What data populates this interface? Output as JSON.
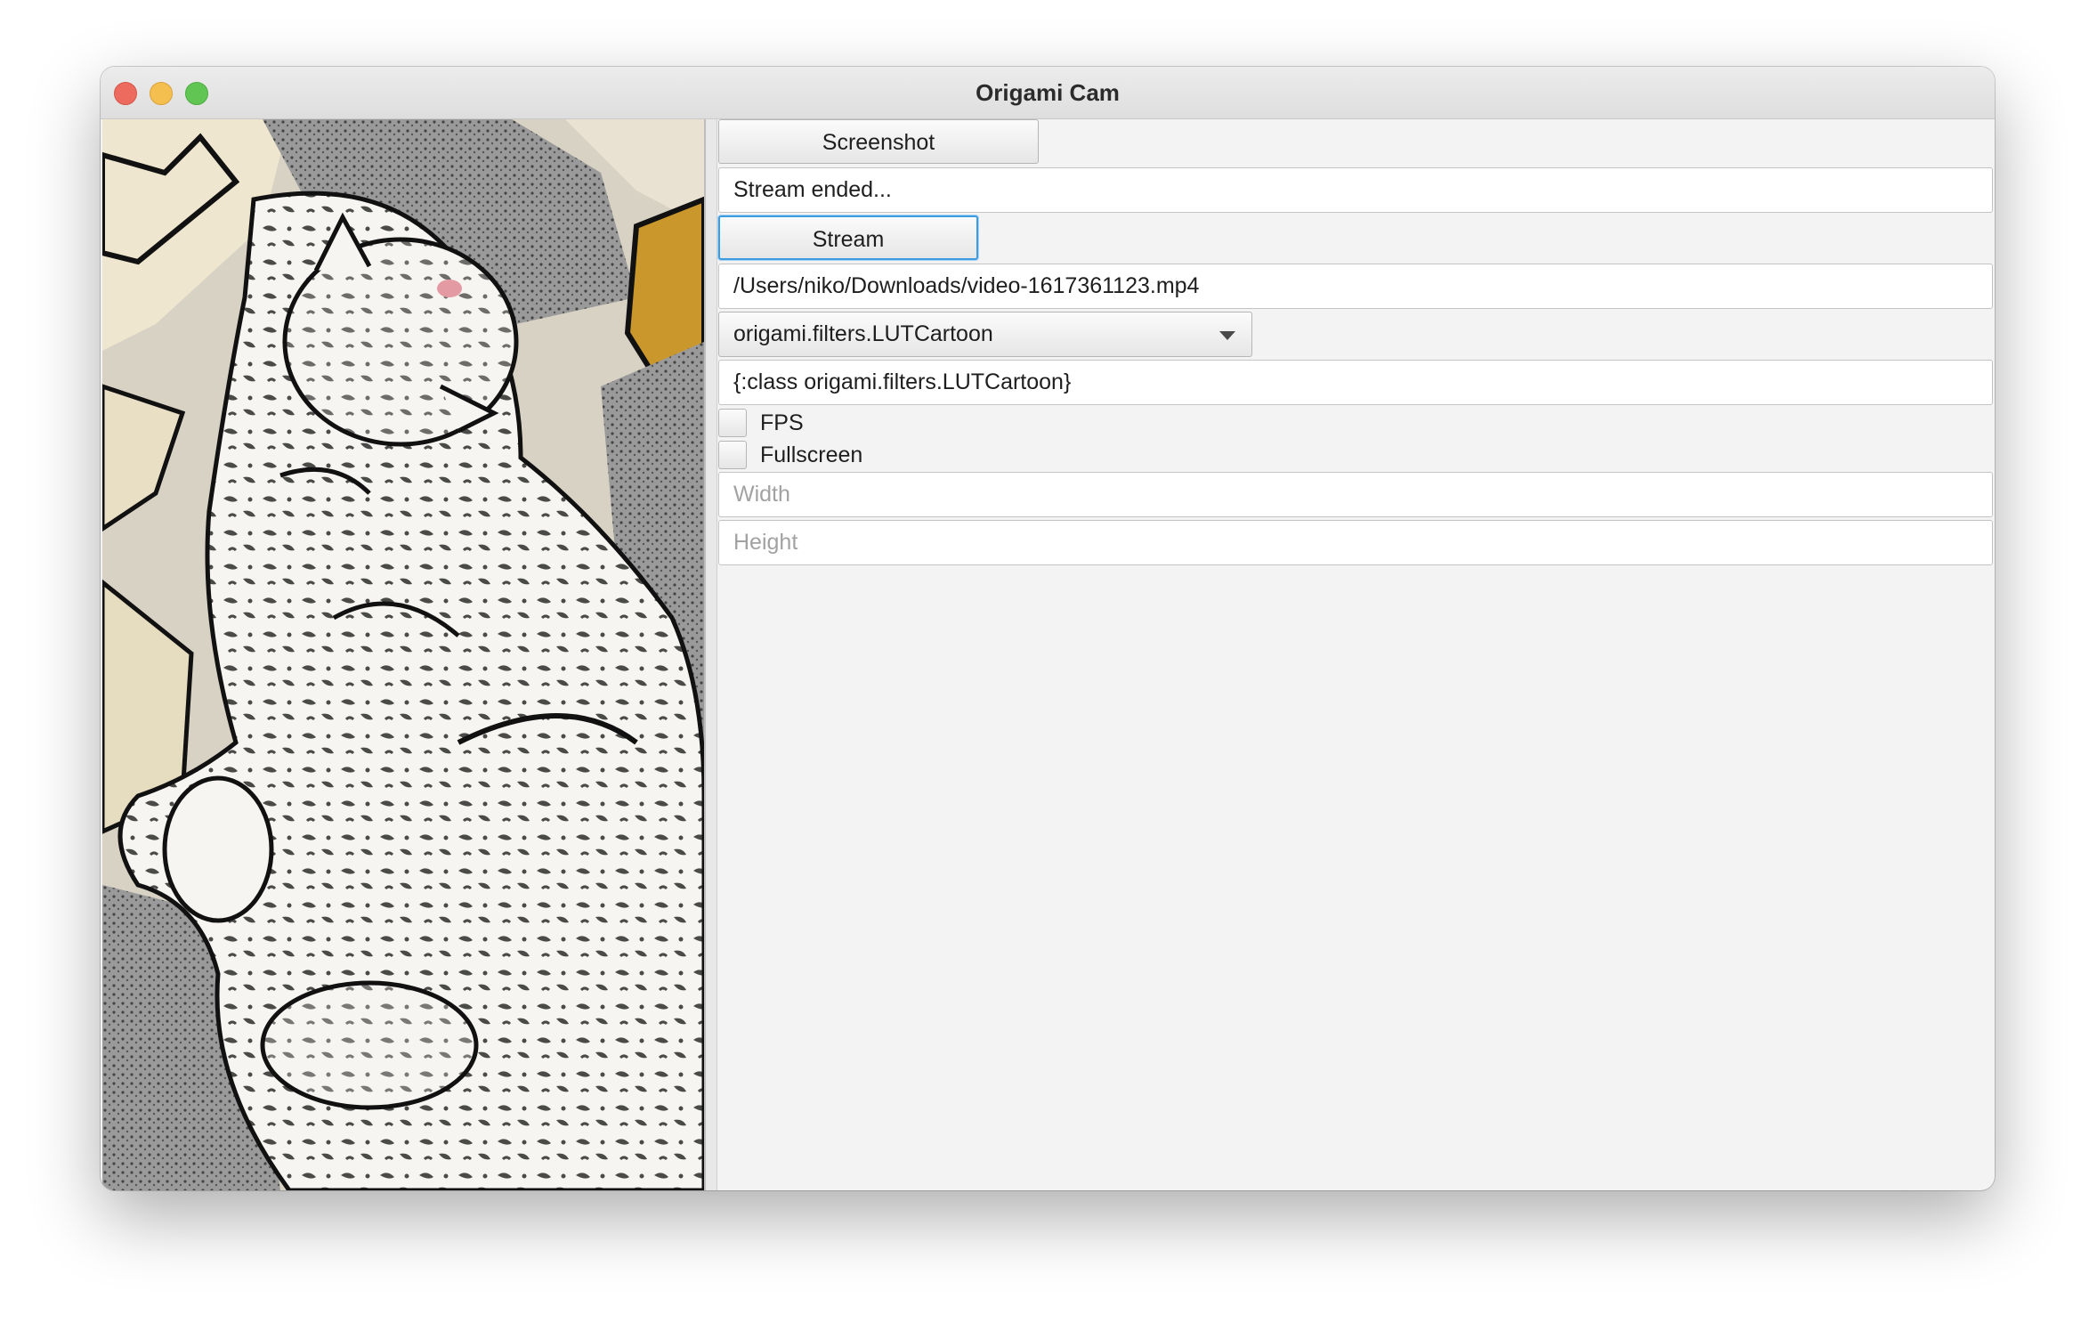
{
  "window": {
    "title": "Origami Cam"
  },
  "preview": {
    "description_icon": "video-preview"
  },
  "controls": {
    "screenshot_label": "Screenshot",
    "status_text": "Stream ended...",
    "stream_label": "Stream",
    "file_path": "/Users/niko/Downloads/video-1617361123.mp4",
    "filter_selected": "origami.filters.LUTCartoon",
    "filter_options_text": "{:class origami.filters.LUTCartoon}",
    "fps_label": "FPS",
    "fullscreen_label": "Fullscreen",
    "width_placeholder": "Width",
    "height_placeholder": "Height"
  },
  "colors": {
    "focus_ring": "#3d9be0",
    "close": "#ed6a5e",
    "minimize": "#f5bf4f",
    "maximize": "#61c554"
  }
}
